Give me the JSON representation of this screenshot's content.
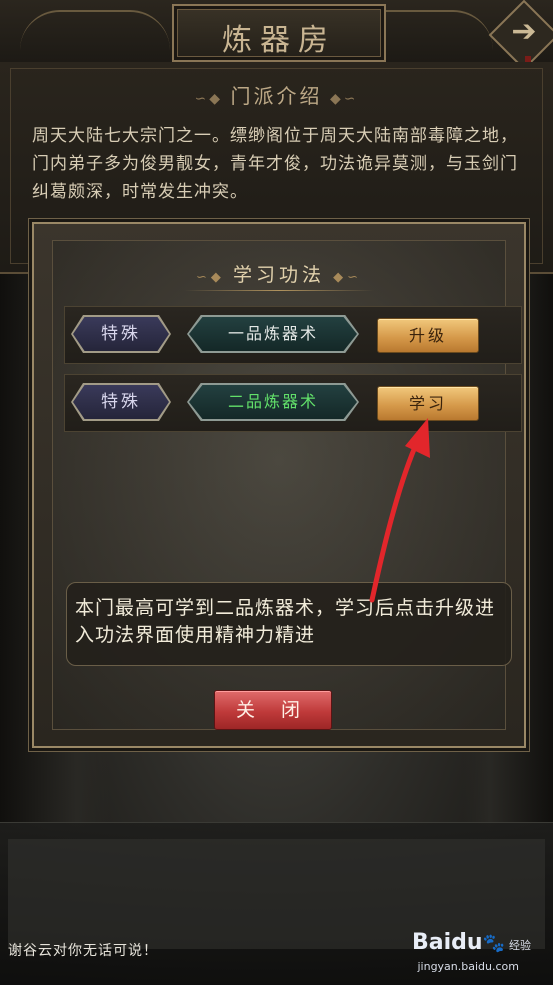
{
  "header": {
    "title": "炼器房",
    "next_arrow": "➔"
  },
  "intro": {
    "heading": "门派介绍",
    "text": "周天大陆七大宗门之一。缥缈阁位于周天大陆南部毒障之地，门内弟子多为俊男靓女，青年才俊，功法诡异莫测，与玉剑门纠葛颇深，时常发生冲突。"
  },
  "dialog": {
    "title": "学习功法",
    "rows": [
      {
        "tag": "特殊",
        "skill": "一品炼器术",
        "action": "升级"
      },
      {
        "tag": "特殊",
        "skill": "二品炼器术",
        "action": "学习"
      }
    ],
    "hint": "本门最高可学到二品炼器术，学习后点击升级进入功法界面使用精神力精进",
    "close_label": "关 闭"
  },
  "chat": {
    "message": "谢谷云对你无话可说！"
  },
  "watermark": {
    "brand": "Baidu",
    "paw": "🐾",
    "sub": "经验",
    "url": "jingyan.baidu.com"
  },
  "colors": {
    "accent_gold": "#d69a4b",
    "close_red": "#bf3a3a",
    "skill_green": "#62e06a",
    "annotation_red": "#e2262b"
  }
}
